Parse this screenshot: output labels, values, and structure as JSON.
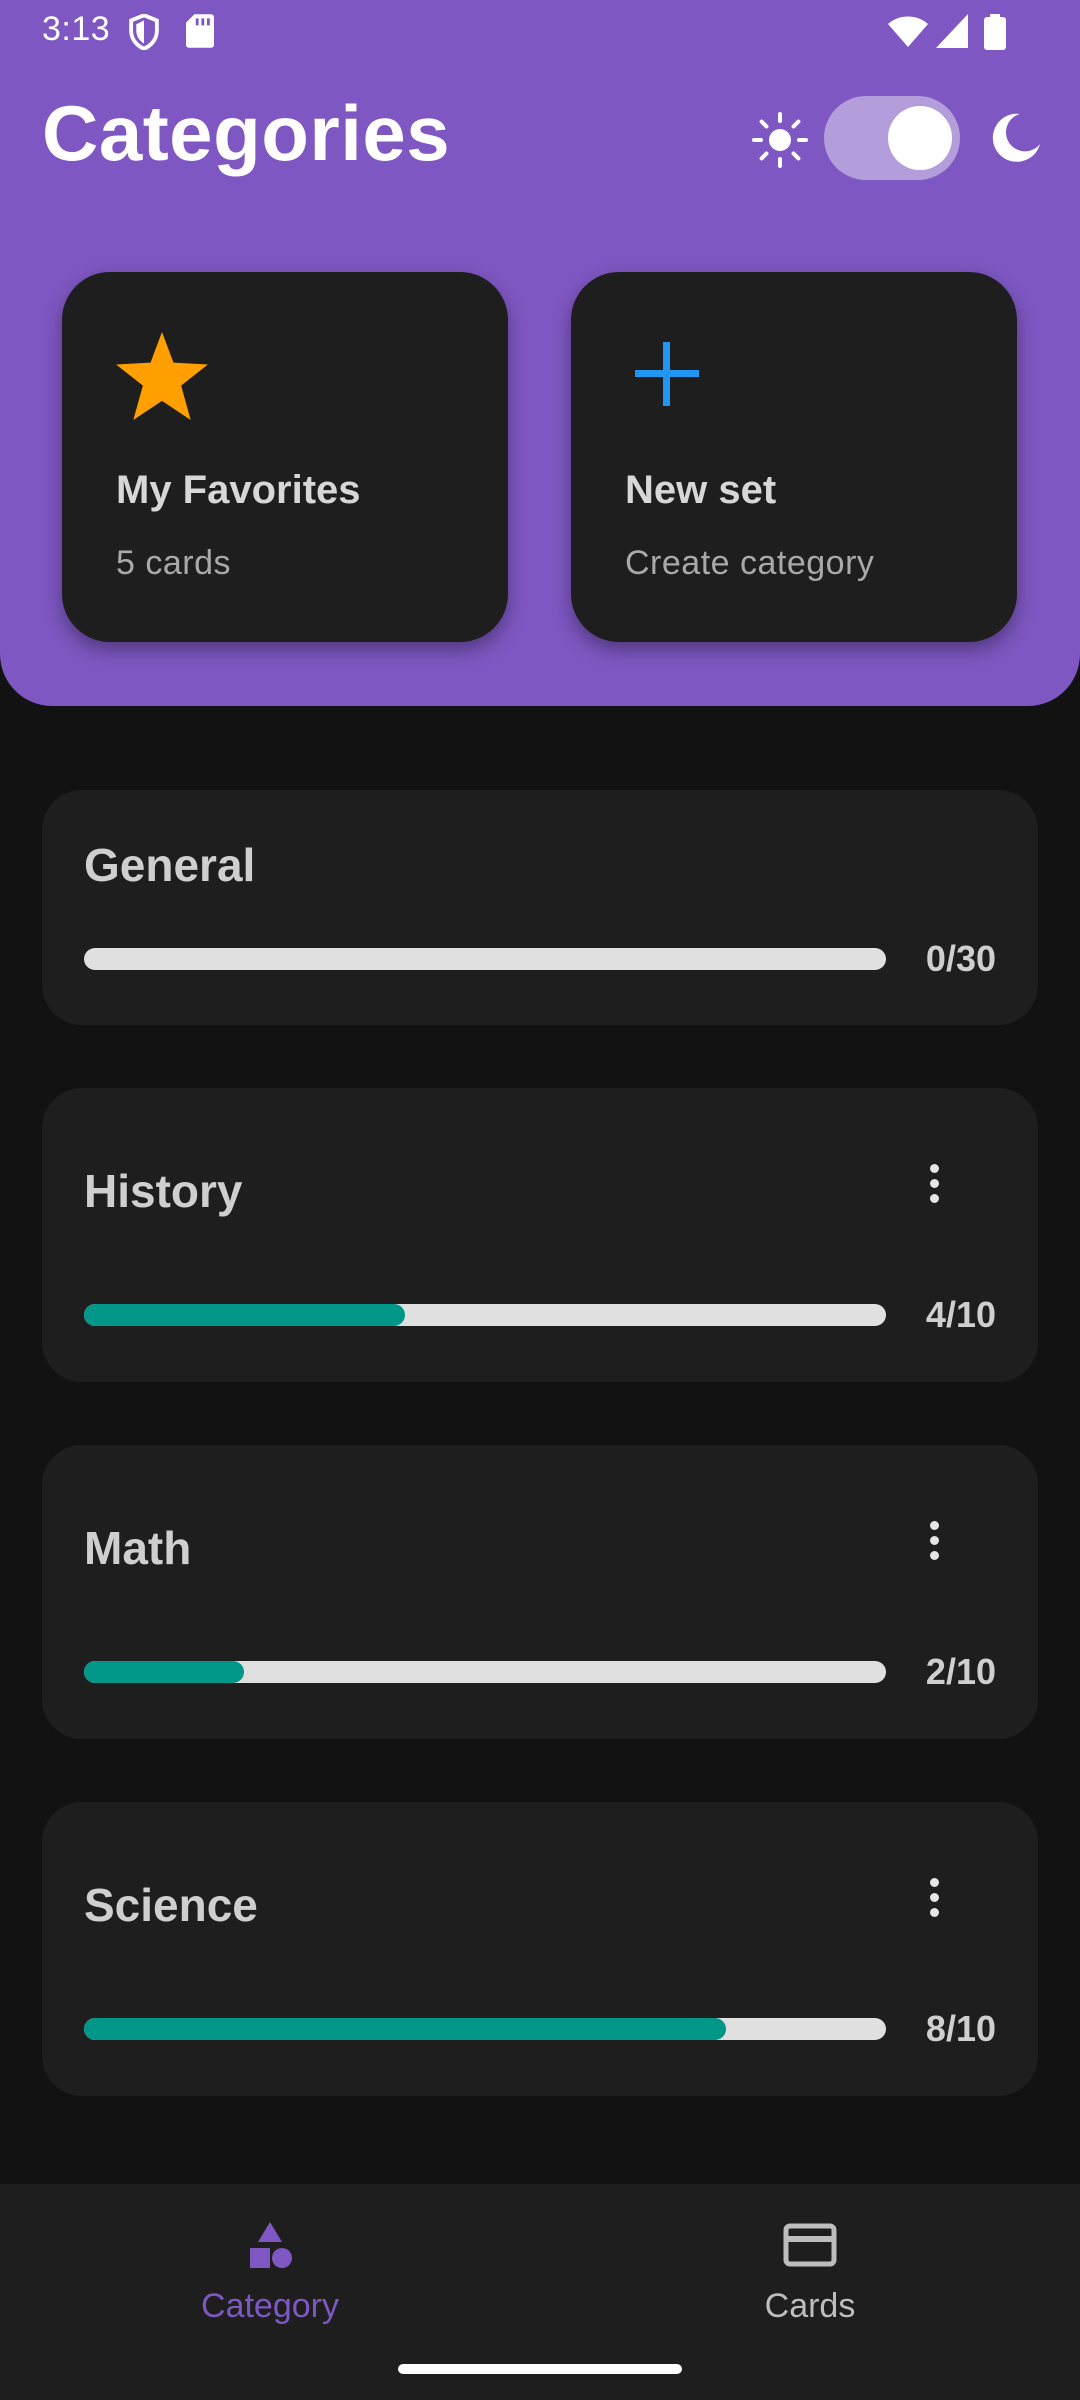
{
  "status_bar": {
    "time": "3:13"
  },
  "header": {
    "title": "Categories"
  },
  "quick_actions": [
    {
      "title": "My Favorites",
      "subtitle": "5 cards",
      "icon": "star-icon"
    },
    {
      "title": "New set",
      "subtitle": "Create category",
      "icon": "plus-icon"
    }
  ],
  "categories": [
    {
      "name": "General",
      "count": "0/30",
      "progress": 0.0
    },
    {
      "name": "History",
      "count": "4/10",
      "progress": 0.4
    },
    {
      "name": "Math",
      "count": "2/10",
      "progress": 0.2
    },
    {
      "name": "Science",
      "count": "8/10",
      "progress": 0.8
    }
  ],
  "bottom_nav": {
    "category_label": "Category",
    "cards_label": "Cards"
  },
  "colors": {
    "header": "#7E57C2",
    "accent": "#7E57C2",
    "progress": "#009688",
    "star": "#FFA000",
    "plus": "#2196F3",
    "card": "#1E1E1E",
    "background": "#121212"
  }
}
